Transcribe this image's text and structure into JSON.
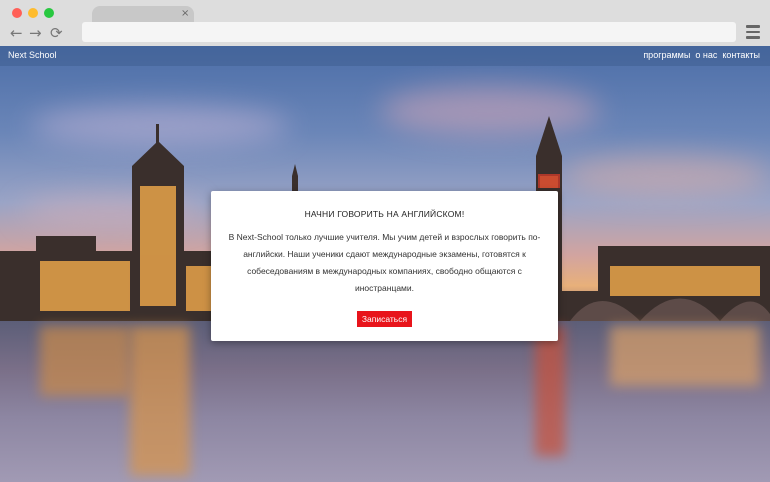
{
  "browser": {
    "tab_close": "×",
    "back_icon": "←",
    "forward_icon": "→",
    "reload_icon": "⟳"
  },
  "site": {
    "brand": "Next School",
    "nav": [
      {
        "label": "программы"
      },
      {
        "label": "о нас"
      },
      {
        "label": "контакты"
      }
    ]
  },
  "modal": {
    "title": "НАЧНИ ГОВОРИТЬ НА АНГЛИЙСКОМ!",
    "text": "В Next-School только лучшие учителя. Мы учим детей и взрослых говорить по-английски. Наши ученики сдают международные экзамены, готовятся к собеседованиям в международных компаниях, свободно общаются с иностранцами.",
    "button": "Записаться",
    "button_color": "#e8141b"
  }
}
